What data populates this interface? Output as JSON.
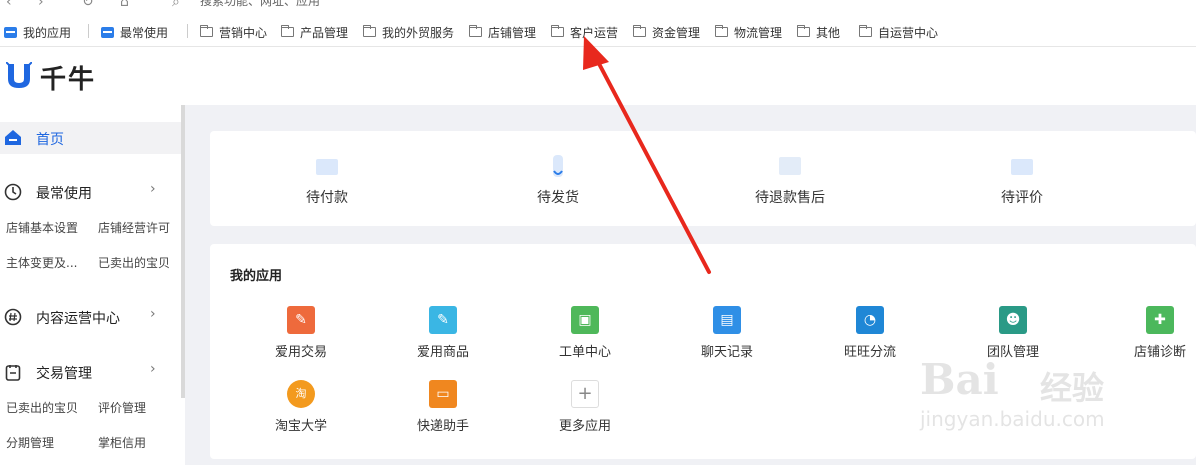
{
  "browser": {
    "search_text": "搜索功能、网址、应用"
  },
  "bookmarks": [
    {
      "label": "我的应用",
      "icon": "app-box-icon"
    },
    {
      "label": "最常使用",
      "icon": "app-box-icon"
    },
    {
      "label": "营销中心",
      "icon": "folder-icon"
    },
    {
      "label": "产品管理",
      "icon": "folder-icon"
    },
    {
      "label": "我的外贸服务",
      "icon": "folder-icon"
    },
    {
      "label": "店铺管理",
      "icon": "folder-icon"
    },
    {
      "label": "客户运营",
      "icon": "folder-icon"
    },
    {
      "label": "资金管理",
      "icon": "folder-icon"
    },
    {
      "label": "物流管理",
      "icon": "folder-icon"
    },
    {
      "label": "其他",
      "icon": "folder-icon"
    },
    {
      "label": "自运营中心",
      "icon": "folder-icon"
    }
  ],
  "header": {
    "logo_text": "千牛"
  },
  "sidebar": {
    "home": "首页",
    "groups": [
      {
        "label": "最常使用",
        "icon": "clock-icon",
        "links": [
          "店铺基本设置",
          "店铺经营许可",
          "主体变更及...",
          "已卖出的宝贝"
        ]
      },
      {
        "label": "内容运营中心",
        "icon": "hash-icon",
        "links": []
      },
      {
        "label": "交易管理",
        "icon": "clipboard-icon",
        "links": [
          "已卖出的宝贝",
          "评价管理",
          "分期管理",
          "掌柜信用"
        ]
      }
    ]
  },
  "orders": [
    {
      "label": "待付款"
    },
    {
      "label": "待发货"
    },
    {
      "label": "待退款售后"
    },
    {
      "label": "待评价"
    }
  ],
  "apps": {
    "title": "我的应用",
    "items": [
      {
        "label": "爱用交易",
        "color": "#ee6a3c",
        "glyph": "✎"
      },
      {
        "label": "爱用商品",
        "color": "#3ab6e4",
        "glyph": "✎"
      },
      {
        "label": "工单中心",
        "color": "#4fb85a",
        "glyph": "▣"
      },
      {
        "label": "聊天记录",
        "color": "#2f8fe6",
        "glyph": "▤"
      },
      {
        "label": "旺旺分流",
        "color": "#1f87d6",
        "glyph": "◔"
      },
      {
        "label": "团队管理",
        "color": "#2a9a86",
        "glyph": "☻"
      },
      {
        "label": "店铺诊断",
        "color": "#4cb85c",
        "glyph": "✚"
      },
      {
        "label": "淘宝大学",
        "color": "#f39a1e",
        "glyph": "淘"
      },
      {
        "label": "快递助手",
        "color": "#f0871f",
        "glyph": "▭"
      },
      {
        "label": "更多应用",
        "color": "#ffffff",
        "glyph": "+"
      }
    ]
  },
  "watermark": {
    "brand": "Bai",
    "brand_cn": "经验",
    "url": "jingyan.baidu.com"
  },
  "colors": {
    "accent": "#1f67e0",
    "arrow": "#e8281d"
  }
}
